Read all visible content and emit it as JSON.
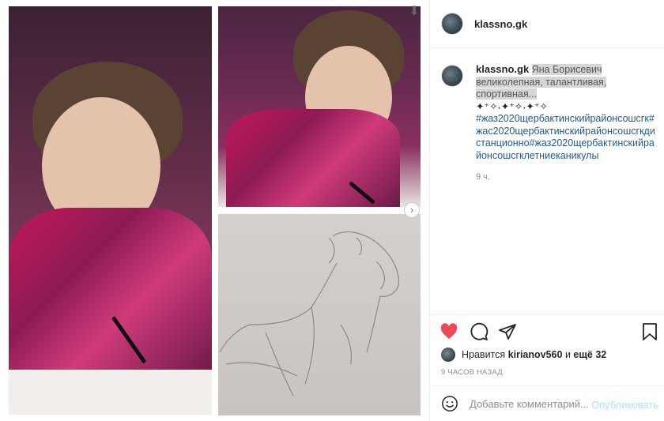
{
  "header": {
    "username": "klassno.gk"
  },
  "caption": {
    "username": "klassno.gk",
    "highlighted_text": "Яна Борисевич великолепная, талантливая, спортивная...",
    "sparkles": "✦⁺✧˖✦⁺✧˖✦⁺✧",
    "hashtags": "#жаз2020щербактинскийрайонсошсгк#жас2020щербактинскийрайонсошсгкдистанционно#жаз2020щербактинскийрайонсошсгклетниеканикулы",
    "time": "9 ч."
  },
  "likes": {
    "prefix": "Нравится",
    "user": "kirianov560",
    "conjunction": "и",
    "others": "ещё 32"
  },
  "post_time": "9 ЧАСОВ НАЗАД",
  "comment": {
    "placeholder": "Добавьте комментарий...",
    "publish_label": "Опубликовать"
  },
  "colors": {
    "like_active": "#ed4956",
    "link": "#1f5a8a",
    "publish_disabled": "#b2dffc"
  },
  "icons": {
    "like": "heart-icon",
    "comment": "speech-bubble-icon",
    "share": "paper-plane-icon",
    "save": "bookmark-icon",
    "emoji": "smiley-icon",
    "download": "download-arrow-icon",
    "next": "chevron-right-icon"
  }
}
